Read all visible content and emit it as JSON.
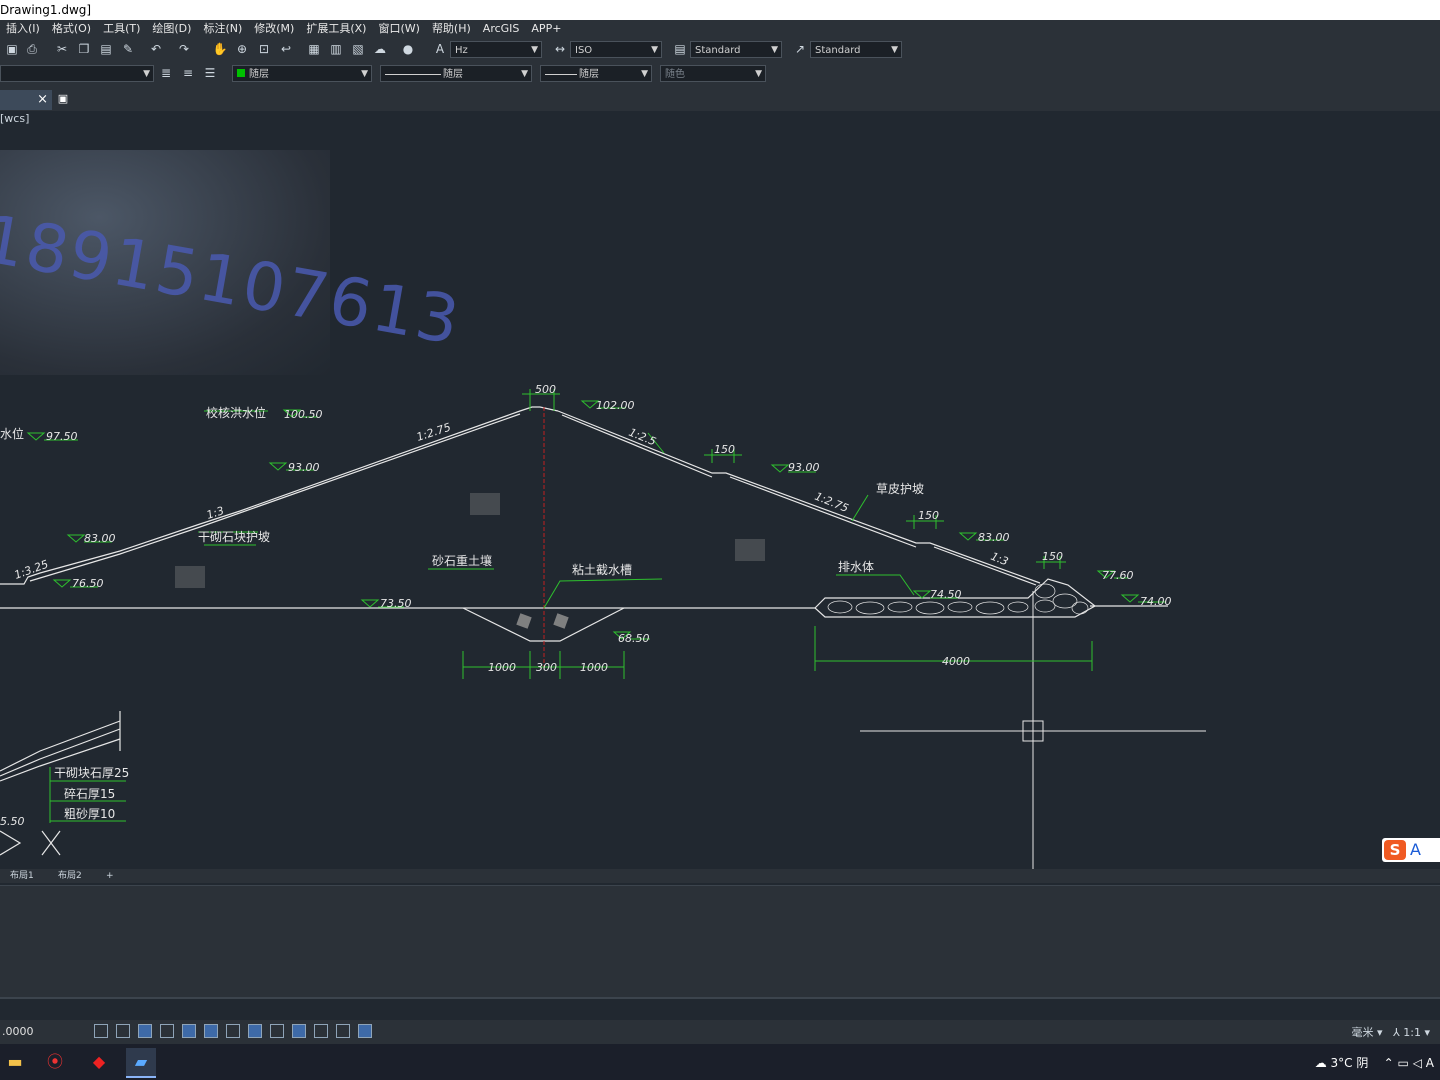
{
  "window": {
    "title": "Drawing1.dwg]"
  },
  "menu": [
    "插入(I)",
    "格式(O)",
    "工具(T)",
    "绘图(D)",
    "标注(N)",
    "修改(M)",
    "扩展工具(X)",
    "窗口(W)",
    "帮助(H)",
    "ArcGIS",
    "APP+"
  ],
  "toolbar": {
    "text_style": "Hz",
    "dim_style": "ISO",
    "table_style": "Standard",
    "multileader_style": "Standard",
    "layer_color": "随层",
    "linetype": "随层",
    "lineweight": "随层",
    "plot_style": "随色"
  },
  "tab": {
    "close": "×"
  },
  "viewport": {
    "label": "[wcs]"
  },
  "watermark": {
    "text": "18915107613"
  },
  "drawing": {
    "labels": {
      "crest_width": "500",
      "crest_elev": "102.00",
      "flood_level": "校核洪水位",
      "flood_elev": "100.50",
      "water_level": "水位",
      "water_elev": "97.50",
      "up_slope1": "1:2.75",
      "up_elev1": "93.00",
      "up_slope2": "1:3",
      "up_slope3": "1:3.25",
      "up_elev2": "83.00",
      "up_elev3": "76.50",
      "up_protect": "干砌石块护坡",
      "core": "砂石重土壤",
      "base_elev": "73.50",
      "cutoff": "粘土截水槽",
      "cutoff_elev": "68.50",
      "dim_left": "1000",
      "dim_mid": "300",
      "dim_right": "1000",
      "down_slope1": "1:2.5",
      "berm1": "150",
      "down_elev1": "93.00",
      "down_slope2": "1:2.75",
      "grass": "草皮护坡",
      "berm2": "150",
      "down_elev2": "83.00",
      "down_slope3": "1:3",
      "berm3": "150",
      "toe_elev": "77.60",
      "drain": "排水体",
      "drain_elev": "74.50",
      "down_base_elev": "74.00",
      "drain_dim": "4000",
      "detail_elev": "5.50",
      "layer1": "干砌块石厚25",
      "layer2": "碎石厚15",
      "layer3": "粗砂厚10"
    }
  },
  "layouts": {
    "tab1": "布局1",
    "tab2": "布局2",
    "add": "+"
  },
  "status": {
    "coords": ".0000",
    "units": "毫米",
    "scale": "1:1"
  },
  "tray": {
    "weather": "3°C 阴",
    "ime": "A"
  },
  "sogou": {
    "s": "S",
    "a": "A"
  }
}
